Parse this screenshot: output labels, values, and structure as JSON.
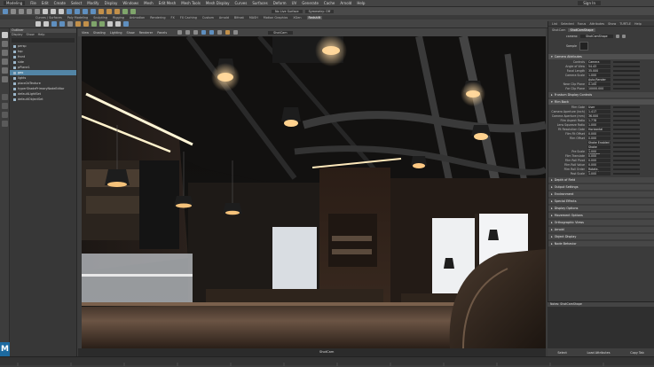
{
  "menubar": {
    "workspace": "Modeling",
    "items": [
      "File",
      "Edit",
      "Create",
      "Select",
      "Modify",
      "Display",
      "Windows",
      "Mesh",
      "Edit Mesh",
      "Mesh Tools",
      "Mesh Display",
      "Curves",
      "Surfaces",
      "Deform",
      "UV",
      "Generate",
      "Cache",
      "Arnold",
      "Help"
    ],
    "signin": "Sign In"
  },
  "statusline": {
    "render_field": "No Live Surface",
    "symmetry": "Symmetry: Off"
  },
  "shelf_tabs": [
    "Curves / Surfaces",
    "Poly Modeling",
    "Sculpting",
    "Rigging",
    "Animation",
    "Rendering",
    "FX",
    "FX Caching",
    "Custom",
    "Arnold",
    "Bifrost",
    "MASH",
    "Motion Graphics",
    "XGen",
    "Redshift"
  ],
  "shelf_active": "Redshift",
  "outliner": {
    "title": "Outliner",
    "menu": [
      "Display",
      "Show",
      "Help"
    ],
    "rows": [
      {
        "label": "persp",
        "selected": false
      },
      {
        "label": "top",
        "selected": false
      },
      {
        "label": "front",
        "selected": false
      },
      {
        "label": "side",
        "selected": false
      },
      {
        "label": "pPlane1",
        "selected": false
      },
      {
        "label": "geo",
        "selected": true
      },
      {
        "label": "lights",
        "selected": false
      },
      {
        "label": "place2dTexture",
        "selected": false
      },
      {
        "label": "hyperShadePrimaryNodeEditor",
        "selected": false
      },
      {
        "label": "defaultLightSet",
        "selected": false
      },
      {
        "label": "defaultObjectSet",
        "selected": false
      }
    ]
  },
  "viewport": {
    "menu": [
      "View",
      "Shading",
      "Lighting",
      "Show",
      "Renderer",
      "Panels"
    ],
    "camera_field": "ShotCam",
    "footer_camera": "ShotCam"
  },
  "attr_editor": {
    "menu": [
      "List",
      "Selected",
      "Focus",
      "Attributes",
      "Show",
      "TURTLE",
      "Help"
    ],
    "tabs": [
      "ShotCam",
      "ShotCamShape"
    ],
    "active_tab": "ShotCamShape",
    "shape_label": "camera:",
    "shape_value": "ShotCamShape",
    "sample_label": "Sample",
    "sections": [
      {
        "title": "Camera Attributes",
        "open": true,
        "rows": [
          {
            "label": "Controls",
            "value": "Camera"
          },
          {
            "label": "Angle of View",
            "value": "54.43"
          },
          {
            "label": "Focal Length",
            "value": "35.000"
          },
          {
            "label": "Camera Scale",
            "value": "1.000"
          },
          {
            "label": "",
            "value": "Auto Render Clip Plane"
          },
          {
            "label": "Near Clip Plane",
            "value": "0.100"
          },
          {
            "label": "Far Clip Plane",
            "value": "10000.000"
          }
        ]
      },
      {
        "title": "Frustum Display Controls",
        "open": false,
        "rows": []
      },
      {
        "title": "Film Back",
        "open": true,
        "rows": [
          {
            "label": "Film Gate",
            "value": "User"
          },
          {
            "label": "Camera Aperture (inch)",
            "value": "1.417"
          },
          {
            "label": "Camera Aperture (mm)",
            "value": "36.000"
          },
          {
            "label": "Film Aspect Ratio",
            "value": "1.778"
          },
          {
            "label": "Lens Squeeze Ratio",
            "value": "1.000"
          },
          {
            "label": "Fit Resolution Gate",
            "value": "Horizontal"
          },
          {
            "label": "Film Fit Offset",
            "value": "0.000"
          },
          {
            "label": "Film Offset",
            "value": "0.000"
          },
          {
            "label": "",
            "value": "Shake Enabled"
          },
          {
            "label": "",
            "value": "Shake Overscan Enabled"
          },
          {
            "label": "Pre Scale",
            "value": "1.000"
          },
          {
            "label": "Film Translate",
            "value": "0.000"
          },
          {
            "label": "Film Roll Pivot",
            "value": "0.000"
          },
          {
            "label": "Film Roll Value",
            "value": "0.000"
          },
          {
            "label": "Film Roll Order",
            "value": "Rotate-Translate"
          },
          {
            "label": "Post Scale",
            "value": "1.000"
          }
        ]
      },
      {
        "title": "Depth of Field",
        "open": false,
        "rows": []
      },
      {
        "title": "Output Settings",
        "open": false,
        "rows": []
      },
      {
        "title": "Environment",
        "open": false,
        "rows": []
      },
      {
        "title": "Special Effects",
        "open": false,
        "rows": []
      },
      {
        "title": "Display Options",
        "open": false,
        "rows": []
      },
      {
        "title": "Movement Options",
        "open": false,
        "rows": []
      },
      {
        "title": "Orthographic Views",
        "open": false,
        "rows": []
      },
      {
        "title": "Arnold",
        "open": false,
        "rows": []
      },
      {
        "title": "Object Display",
        "open": false,
        "rows": []
      },
      {
        "title": "Node Behavior",
        "open": false,
        "rows": []
      }
    ],
    "notes_title": "Notes: ShotCamShape",
    "buttons": [
      "Select",
      "Load Attributes",
      "Copy Tab"
    ]
  },
  "logo": "M",
  "colors": {
    "selection": "#5285a6",
    "maya_blue": "#1d6aa0"
  }
}
